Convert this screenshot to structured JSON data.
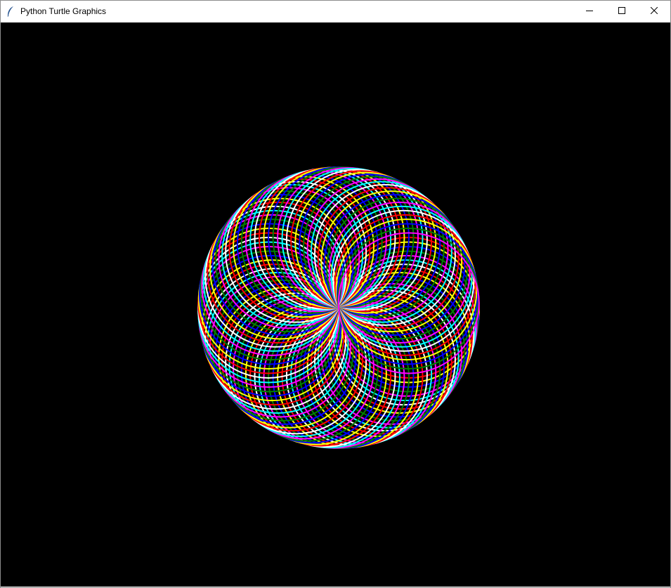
{
  "window": {
    "title": "Python Turtle Graphics",
    "controls": {
      "minimize": "minimize-icon",
      "maximize": "maximize-icon",
      "close": "close-icon"
    }
  },
  "canvas": {
    "background": "#000000",
    "pen_colors": [
      "#ff0000",
      "#ffff00",
      "#0000ff",
      "#008000",
      "#ff00ff",
      "#00ffff",
      "#ffffff"
    ]
  }
}
